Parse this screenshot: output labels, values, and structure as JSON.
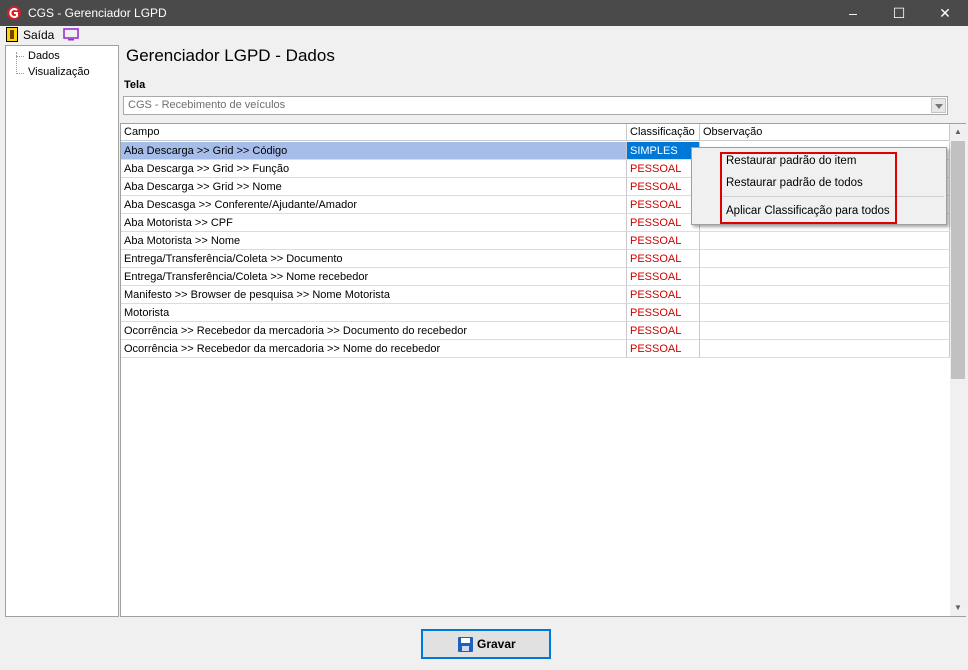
{
  "window": {
    "title": "CGS - Gerenciador LGPD",
    "minimize_glyph": "‒",
    "maximize_glyph": "☐",
    "close_glyph": "✕"
  },
  "menu": {
    "exit_label": "Saída",
    "exit_icon": "exit-door-icon",
    "monitor_icon": "monitor-icon"
  },
  "tree": {
    "items": [
      {
        "label": "Dados"
      },
      {
        "label": "Visualização"
      }
    ]
  },
  "main": {
    "title": "Gerenciador LGPD - Dados",
    "tela_label": "Tela",
    "tela_value": "CGS - Recebimento de veículos"
  },
  "grid": {
    "columns": [
      "Campo",
      "Classificação",
      "Observação"
    ],
    "rows": [
      {
        "campo": "Aba Descarga >> Grid >> Código",
        "classificacao": "SIMPLES",
        "observacao": "",
        "selected": true
      },
      {
        "campo": "Aba Descarga >> Grid >> Função",
        "classificacao": "PESSOAL",
        "observacao": ""
      },
      {
        "campo": "Aba Descarga >> Grid >> Nome",
        "classificacao": "PESSOAL",
        "observacao": ""
      },
      {
        "campo": "Aba Descasga >> Conferente/Ajudante/Amador",
        "classificacao": "PESSOAL",
        "observacao": ""
      },
      {
        "campo": "Aba Motorista >> CPF",
        "classificacao": "PESSOAL",
        "observacao": ""
      },
      {
        "campo": "Aba Motorista >> Nome",
        "classificacao": "PESSOAL",
        "observacao": ""
      },
      {
        "campo": "Entrega/Transferência/Coleta >> Documento",
        "classificacao": "PESSOAL",
        "observacao": ""
      },
      {
        "campo": "Entrega/Transferência/Coleta >> Nome recebedor",
        "classificacao": "PESSOAL",
        "observacao": ""
      },
      {
        "campo": "Manifesto >> Browser de pesquisa >> Nome Motorista",
        "classificacao": "PESSOAL",
        "observacao": ""
      },
      {
        "campo": "Motorista",
        "classificacao": "PESSOAL",
        "observacao": ""
      },
      {
        "campo": "Ocorrência >> Recebedor da mercadoria >> Documento do recebedor",
        "classificacao": "PESSOAL",
        "observacao": ""
      },
      {
        "campo": "Ocorrência >> Recebedor da mercadoria >> Nome do recebedor",
        "classificacao": "PESSOAL",
        "observacao": ""
      }
    ]
  },
  "context_menu": {
    "items": [
      "Restaurar padrão do item",
      "Restaurar padrão de todos",
      "Aplicar Classificação para todos"
    ]
  },
  "footer": {
    "save_label": "Gravar",
    "save_icon": "floppy-disk-icon"
  },
  "colors": {
    "titlebar": "#4a4a4a",
    "pessoal_text": "#d00000",
    "selection_blue": "#0078d7",
    "row_highlight": "#a6bde9",
    "annotation_red": "#e00000"
  }
}
